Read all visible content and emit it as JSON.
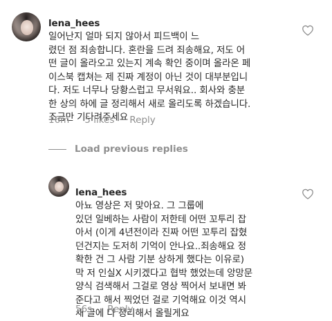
{
  "comments": [
    {
      "username": "lena_hees",
      "text": "일어난지 얼마 되지 않아서 피드백이 느\n렸던 점 죄송합니다. 혼란을 드려 죄송해요, 저도 어\n떤 글이 올라오고 있는지 계속 확인 중이며 올라온 페\n이스북 캡쳐는 제 진짜 계정이 아닌 것이 대부분입니\n다. 저도 너무나 당황스럽고 무서워요.. 회사와 충분\n한 상의 하에 글 정리해서 새로 올리도록 하겠습니다.\n조금만 기다려주세요",
      "time": "16m",
      "likes": "5 likes",
      "reply": "Reply",
      "heart_icon": "heart-outline-icon"
    },
    {
      "username": "lena_hees",
      "text": "아뇨 영상은 저 맞아요. 그 그룹에\n있던 일베하는 사람이 저한테 어떤 꼬투리 잡\n아서 (이게 4년전이라 진짜 어떤 꼬투리 잡혔\n던건지는 도저히 기억이 안나요..죄송해요 정\n확한 건 그 사람 기분 상하게 했다는 이유로)\n막 저 인실X 시키겠다고 협박 했었는데 앙망문\n양식 검색해서 그걸로 영상 찍어서 보내면 봐\n준다고 해서 찍었던 걸로 기억해요 이것 역시\n새 글에 다 정리해서 올릴게요",
      "time": "56s",
      "reply": "Reply",
      "heart_icon": "heart-outline-icon"
    }
  ],
  "load_previous": {
    "label": "Load previous replies"
  },
  "colors": {
    "text": "#262626",
    "muted": "#8e8e8e",
    "background": "#ffffff"
  }
}
